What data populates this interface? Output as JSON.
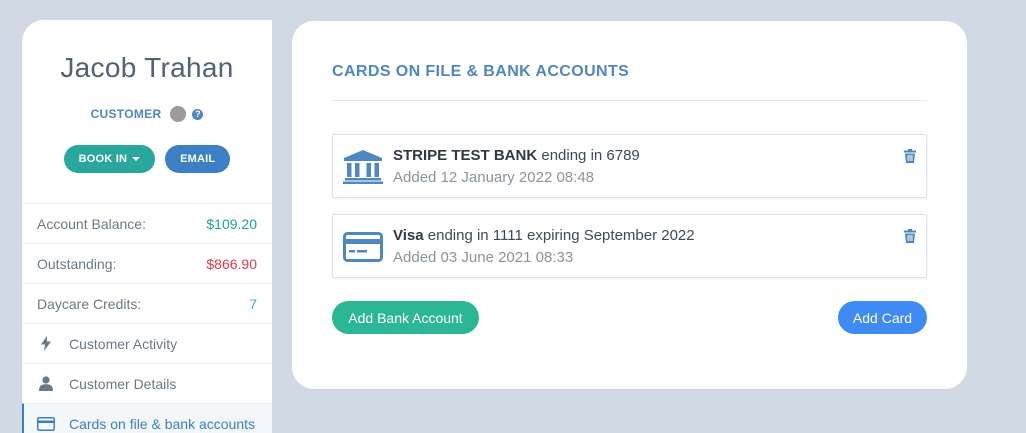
{
  "customer": {
    "name": "Jacob Trahan",
    "role": "CUSTOMER",
    "help": "?",
    "book_in_label": "BOOK IN",
    "email_label": "EMAIL"
  },
  "stats": [
    {
      "label": "Account Balance:",
      "value": "$109.20",
      "color": "#1aa596"
    },
    {
      "label": "Outstanding:",
      "value": "$866.90",
      "color": "#e0384c"
    },
    {
      "label": "Daycare Credits:",
      "value": "7",
      "color": "#3aa9d2"
    }
  ],
  "nav": [
    {
      "label": "Customer Activity",
      "icon": "bolt-icon"
    },
    {
      "label": "Customer Details",
      "icon": "user-icon"
    },
    {
      "label": "Cards on file & bank accounts",
      "icon": "credit-card-icon",
      "active": true
    }
  ],
  "main": {
    "title": "CARDS ON FILE & BANK ACCOUNTS",
    "items": [
      {
        "icon": "bank-icon",
        "name": "STRIPE TEST BANK",
        "detail": " ending in 6789",
        "added": "Added 12 January 2022 08:48"
      },
      {
        "icon": "credit-card-icon",
        "name": "Visa",
        "detail": " ending in 1111 expiring September 2022",
        "added": "Added 03 June 2021 08:33"
      }
    ],
    "add_bank_label": "Add Bank Account",
    "add_card_label": "Add Card"
  },
  "colors": {
    "background": "#d1dae4",
    "accent_blue": "#4f87c1",
    "green_button": "#2bb694",
    "blue_button": "#3f8bf5"
  }
}
